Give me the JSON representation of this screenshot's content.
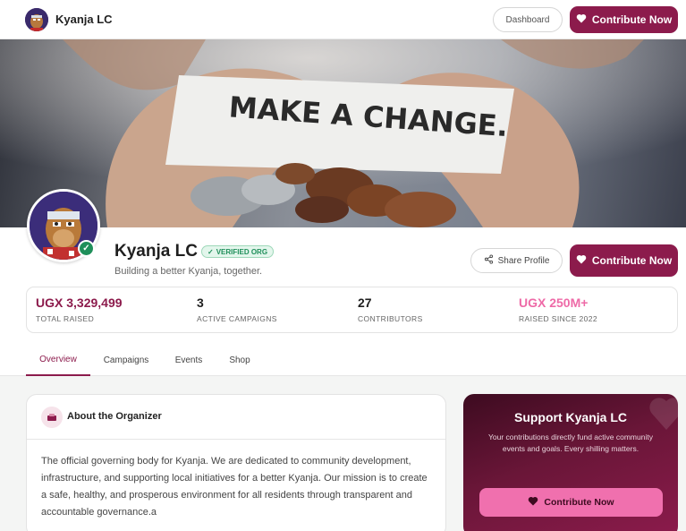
{
  "nav": {
    "org_name": "Kyanja LC",
    "dashboard_label": "Dashboard",
    "contribute_label": "Contribute Now"
  },
  "hero": {
    "note_text": "MAKE A CHANGE."
  },
  "profile": {
    "name": "Kyanja LC",
    "verified_label": "VERIFIED ORG",
    "tagline": "Building a better Kyanja, together.",
    "share_label": "Share Profile",
    "contribute_label": "Contribute Now"
  },
  "stats": [
    {
      "value": "UGX 3,329,499",
      "label": "TOTAL RAISED",
      "color": "#8c1b4c"
    },
    {
      "value": "3",
      "label": "ACTIVE CAMPAIGNS",
      "color": "#1f1f1f"
    },
    {
      "value": "27",
      "label": "CONTRIBUTORS",
      "color": "#1f1f1f"
    },
    {
      "value": "UGX 250M+",
      "label": "RAISED SINCE 2022",
      "color": "#ee6aa7"
    }
  ],
  "tabs": [
    {
      "label": "Overview",
      "active": true
    },
    {
      "label": "Campaigns",
      "active": false
    },
    {
      "label": "Events",
      "active": false
    },
    {
      "label": "Shop",
      "active": false
    }
  ],
  "about": {
    "title": "About the Organizer",
    "body": "The official governing body for Kyanja. We are dedicated to community development, infrastructure, and supporting local initiatives for a better Kyanja. Our mission is to create a safe, healthy, and prosperous environment for all residents through transparent and accountable governance.a"
  },
  "support": {
    "title": "Support Kyanja LC",
    "description": "Your contributions directly fund active community events and goals. Every shilling matters.",
    "contribute_label": "Contribute Now"
  },
  "colors": {
    "brand": "#8c1b4c",
    "accent_pink": "#ee6aa7",
    "verified_green": "#1f8f5a"
  },
  "icons": {
    "heart": "heart-icon",
    "share": "share-icon",
    "check": "check-icon",
    "organizer": "organizer-icon"
  }
}
